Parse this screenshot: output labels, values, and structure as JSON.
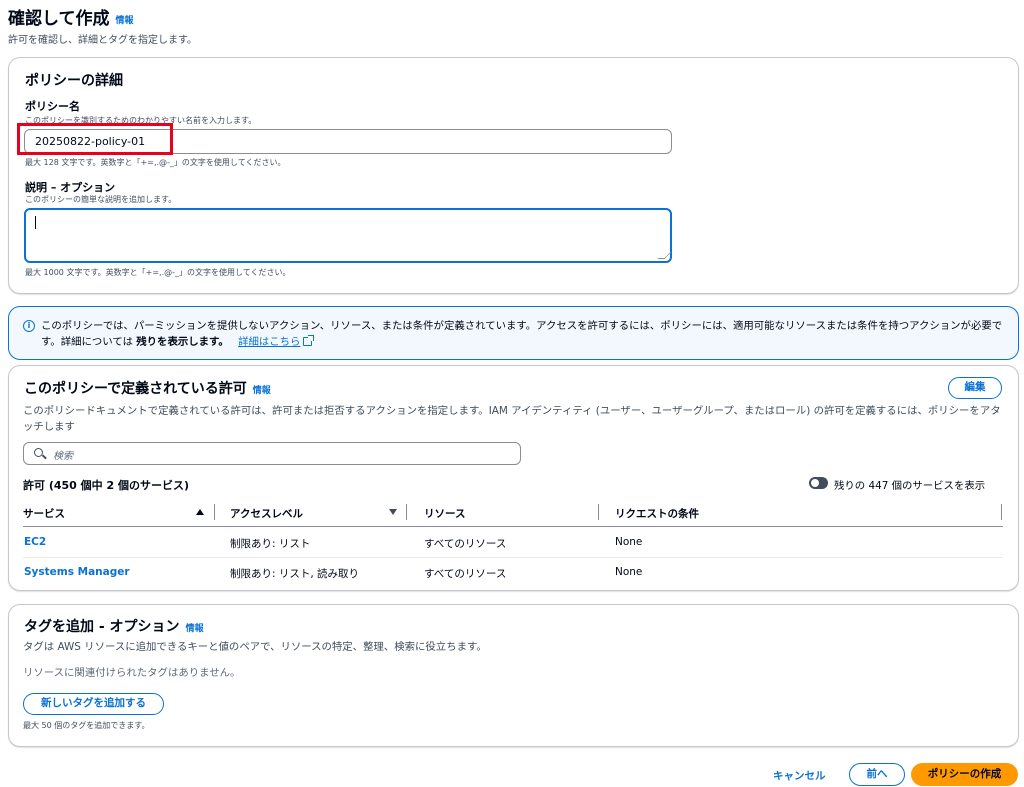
{
  "header": {
    "title": "確認して作成",
    "info": "情報",
    "subtitle": "許可を確認し、詳細とタグを指定します。"
  },
  "details": {
    "title": "ポリシーの詳細",
    "name_label": "ポリシー名",
    "name_desc": "このポリシーを識別するためのわかりやすい名前を入力します。",
    "name_value": "20250822-policy-01",
    "name_hint": "最大 128 文字です。英数字と「+=,.@-_」の文字を使用してください。",
    "desc_label": "説明 – オプション",
    "desc_desc": "このポリシーの簡単な説明を追加します。",
    "desc_value": "",
    "desc_hint": "最大 1000 文字です。英数字と「+=,.@-_」の文字を使用してください。"
  },
  "alert": {
    "icon": "info-circle-icon",
    "text": "このポリシーでは、パーミッションを提供しないアクション、リソース、または条件が定義されています。アクセスを許可するには、ポリシーには、適用可能なリソースまたは条件を持つアクションが必要です。詳細については",
    "strong": "残りを表示します。",
    "link": "詳細はこちら"
  },
  "permissions": {
    "title": "このポリシーで定義されている許可",
    "info": "情報",
    "edit_button": "編集",
    "description": "このポリシードキュメントで定義されている許可は、許可または拒否するアクションを指定します。IAM アイデンティティ (ユーザー、ユーザーグループ、またはロール) の許可を定義するには、ポリシーをアタッチします",
    "search_placeholder": "検索",
    "count_label": "許可 (450 個中 2 個のサービス)",
    "toggle_label": "残りの 447 個のサービスを表示",
    "columns": [
      "サービス",
      "アクセスレベル",
      "リソース",
      "リクエストの条件"
    ],
    "rows": [
      {
        "service": "EC2",
        "access": "制限あり: リスト",
        "resource": "すべてのリソース",
        "condition": "None"
      },
      {
        "service": "Systems Manager",
        "access": "制限あり: リスト, 読み取り",
        "resource": "すべてのリソース",
        "condition": "None"
      }
    ]
  },
  "tags": {
    "title": "タグを追加 - オプション",
    "info": "情報",
    "description": "タグは AWS リソースに追加できるキーと値のペアで、リソースの特定、整理、検索に役立ちます。",
    "empty": "リソースに関連付けられたタグはありません。",
    "add_button": "新しいタグを追加する",
    "limit": "最大 50 個のタグを追加できます。"
  },
  "footer": {
    "cancel": "キャンセル",
    "previous": "前へ",
    "create": "ポリシーの作成"
  },
  "colors": {
    "link": "#0972d3",
    "primary": "#ff9900",
    "highlight": "#e8001c",
    "alert_bg": "#f2f8fd"
  }
}
